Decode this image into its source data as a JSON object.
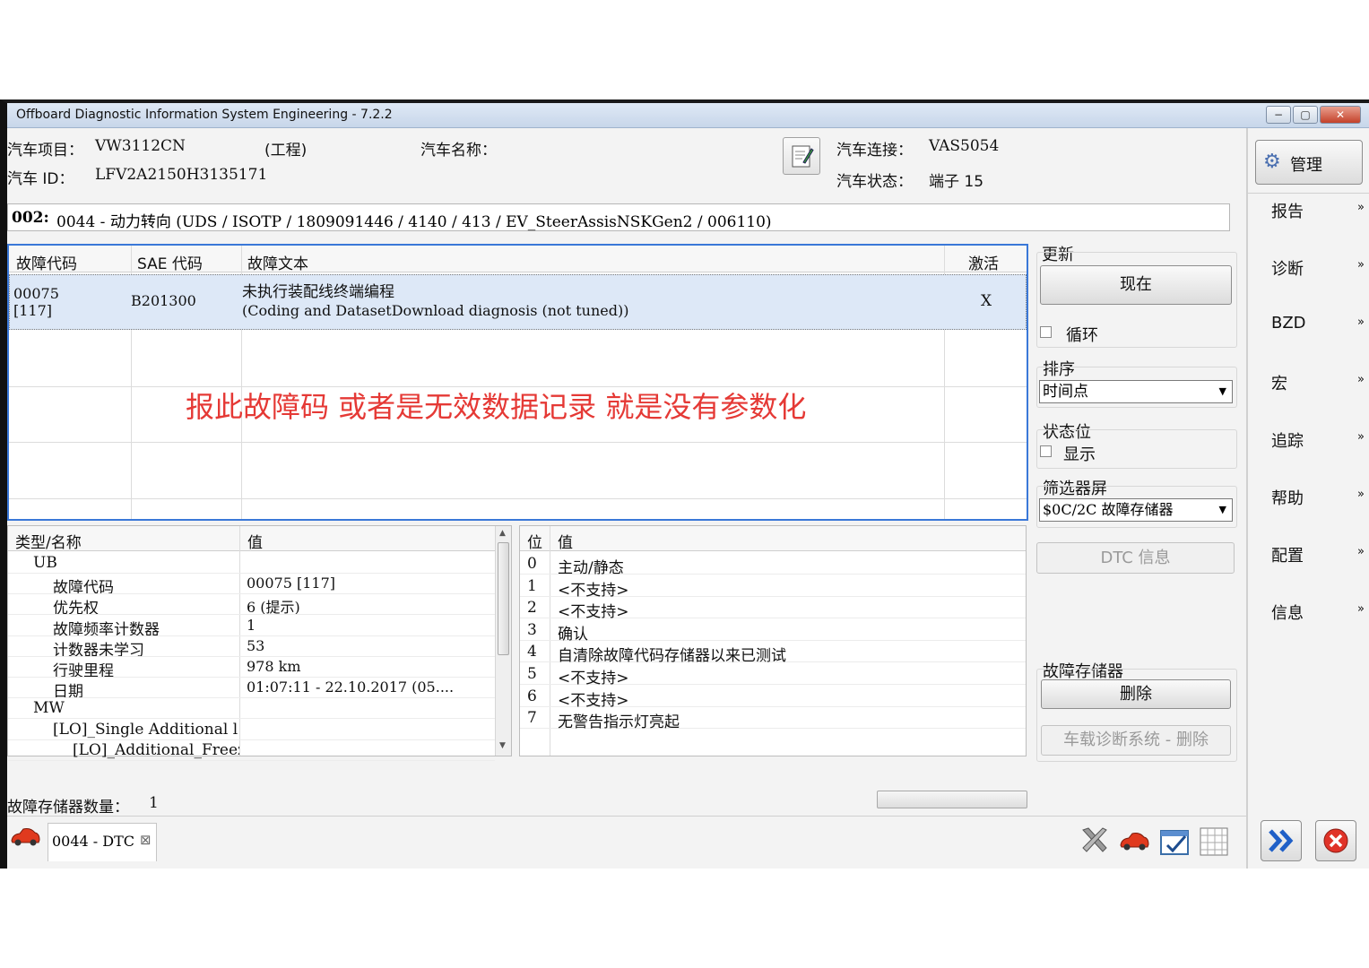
{
  "window": {
    "title": "Offboard Diagnostic Information System Engineering - 7.2.2",
    "min": "−",
    "max": "▢",
    "close": "✕"
  },
  "info": {
    "project_label": "汽车项目：",
    "project_value": "VW3112CN",
    "project_mode": "(工程)",
    "name_label": "汽车名称：",
    "id_label": "汽车 ID：",
    "id_value": "LFV2A2150H3135171",
    "conn_label": "汽车连接：",
    "conn_value": "VAS5054",
    "state_label": "汽车状态：",
    "state_value": "端子 15"
  },
  "manage_label": "管理",
  "ecu": {
    "prefix": "002:",
    "text": "0044 - 动力转向  (UDS / ISOTP / 1809091446 / 4140 / 413 / EV_SteerAssisNSKGen2 / 006110)"
  },
  "dtc_table": {
    "headers": [
      "故障代码",
      "SAE 代码",
      "故障文本",
      "激活"
    ],
    "rows": [
      {
        "code": "00075",
        "code2": "[117]",
        "sae": "B201300",
        "text": "未执行装配线终端编程",
        "text2": "(Coding and DatasetDownload diagnosis (not tuned))",
        "active": "X"
      }
    ]
  },
  "annotation": "报此故障码  或者是无效数据记录  就是没有参数化",
  "controls": {
    "update_label": "更新",
    "now_button": "现在",
    "loop_label": "循环",
    "sort_label": "排序",
    "sort_value": "时间点",
    "status_label": "状态位",
    "show_label": "显示",
    "filter_label": "筛选器屏",
    "filter_value": "$0C/2C 故障存储器",
    "dtc_info_button": "DTC 信息",
    "memory_label": "故障存储器",
    "delete_button": "删除",
    "obd_delete_button": "车载诊断系统 - 删除"
  },
  "detail": {
    "headers": [
      "类型/名称",
      "值"
    ],
    "rows": [
      {
        "name": "UB",
        "value": ""
      },
      {
        "name": "故障代码",
        "value": "00075 [117]"
      },
      {
        "name": "优先权",
        "value": "6  (提示)"
      },
      {
        "name": "故障频率计数器",
        "value": "1"
      },
      {
        "name": "计数器未学习",
        "value": "53"
      },
      {
        "name": "行驶里程",
        "value": "978 km"
      },
      {
        "name": "日期",
        "value": "01:07:11 - 22.10.2017  (05...."
      },
      {
        "name": "MW",
        "value": ""
      },
      {
        "name": "[LO]_Single Additional l",
        "value": ""
      },
      {
        "name": "[LO]_Additional_Freez",
        "value": ""
      }
    ]
  },
  "status_bits": {
    "headers": [
      "位",
      "值"
    ],
    "rows": [
      {
        "bit": "0",
        "value": "主动/静态"
      },
      {
        "bit": "1",
        "value": "<不支持>"
      },
      {
        "bit": "2",
        "value": "<不支持>"
      },
      {
        "bit": "3",
        "value": "确认"
      },
      {
        "bit": "4",
        "value": "自清除故障代码存储器以来已测试"
      },
      {
        "bit": "5",
        "value": "<不支持>"
      },
      {
        "bit": "6",
        "value": "<不支持>"
      },
      {
        "bit": "7",
        "value": "无警告指示灯亮起"
      }
    ]
  },
  "footer": {
    "count_label": "故障存储器数量：",
    "count_value": "1",
    "tab_label": "0044 - DTC",
    "tab_close": "⊠"
  },
  "sidebar": {
    "items": [
      "报告",
      "诊断",
      "BZD",
      "宏",
      "追踪",
      "帮助",
      "配置",
      "信息"
    ],
    "chevron": "»"
  },
  "colors": {
    "accent": "#3a78d8",
    "selected_row": "#dde8f7",
    "annotation": "#e53935"
  }
}
